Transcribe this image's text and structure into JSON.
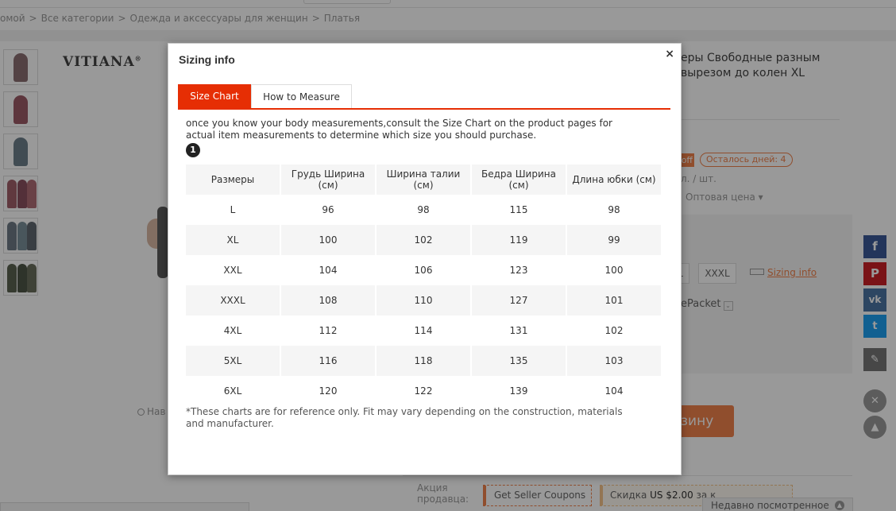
{
  "breadcrumb": {
    "items": [
      "омой",
      "Все категории",
      "Одежда и аксессуары для женщин",
      "Платья"
    ],
    "separator": ">"
  },
  "brand": {
    "name": "VITIANA",
    "mark": "®"
  },
  "product": {
    "title": "еры Свободные разным вырезом до колен XL",
    "off_badge": "off",
    "days_left_badge": "Осталось дней: 4",
    "per_piece": "л. / шт.",
    "wholesale": "Оптовая цена ▾",
    "size_partial": "L",
    "size_xxxl": "XXXL",
    "sizing_info_link": "Sizing info",
    "shipping": "ePacket",
    "shipping_chevron": "⌄",
    "add_to_cart": "зину"
  },
  "gallery": {
    "nav_hint": "Нав"
  },
  "promo": {
    "label": "Акция продавца:",
    "coupon": "Get Seller Coupons",
    "coupon_arrow": "▾",
    "discount_prefix": "Скидка ",
    "discount_amount": "US $2.00",
    "discount_suffix": " за к"
  },
  "recently_viewed": {
    "label": "Недавно посмотренное",
    "up_glyph": "▲"
  },
  "social": {
    "fb": "f",
    "pin": "P",
    "vk": "vk",
    "tw": "t",
    "edit": "✎",
    "close": "✕",
    "up": "▲"
  },
  "modal": {
    "title": "Sizing info",
    "close_glyph": "×",
    "tabs": [
      {
        "label": "Size Chart",
        "active": true
      },
      {
        "label": "How to Measure",
        "active": false
      }
    ],
    "intro": "once you know your body measurements,consult the Size Chart on the product pages for actual item measurements to determine which size you should purchase.",
    "step": "1",
    "table": {
      "headers": [
        "Размеры",
        "Грудь Ширина (см)",
        "Ширина талии (см)",
        "Бедра Ширина (см)",
        "Длина юбки (см)"
      ],
      "rows": [
        [
          "L",
          "96",
          "98",
          "115",
          "98"
        ],
        [
          "XL",
          "100",
          "102",
          "119",
          "99"
        ],
        [
          "XXL",
          "104",
          "106",
          "123",
          "100"
        ],
        [
          "XXXL",
          "108",
          "110",
          "127",
          "101"
        ],
        [
          "4XL",
          "112",
          "114",
          "131",
          "102"
        ],
        [
          "5XL",
          "116",
          "118",
          "135",
          "103"
        ],
        [
          "6XL",
          "120",
          "122",
          "139",
          "104"
        ]
      ]
    },
    "note": "*These charts are for reference only. Fit may vary depending on the construction, materials and manufacturer."
  },
  "colors": {
    "accent": "#e62e04",
    "orange": "#f0824c"
  }
}
